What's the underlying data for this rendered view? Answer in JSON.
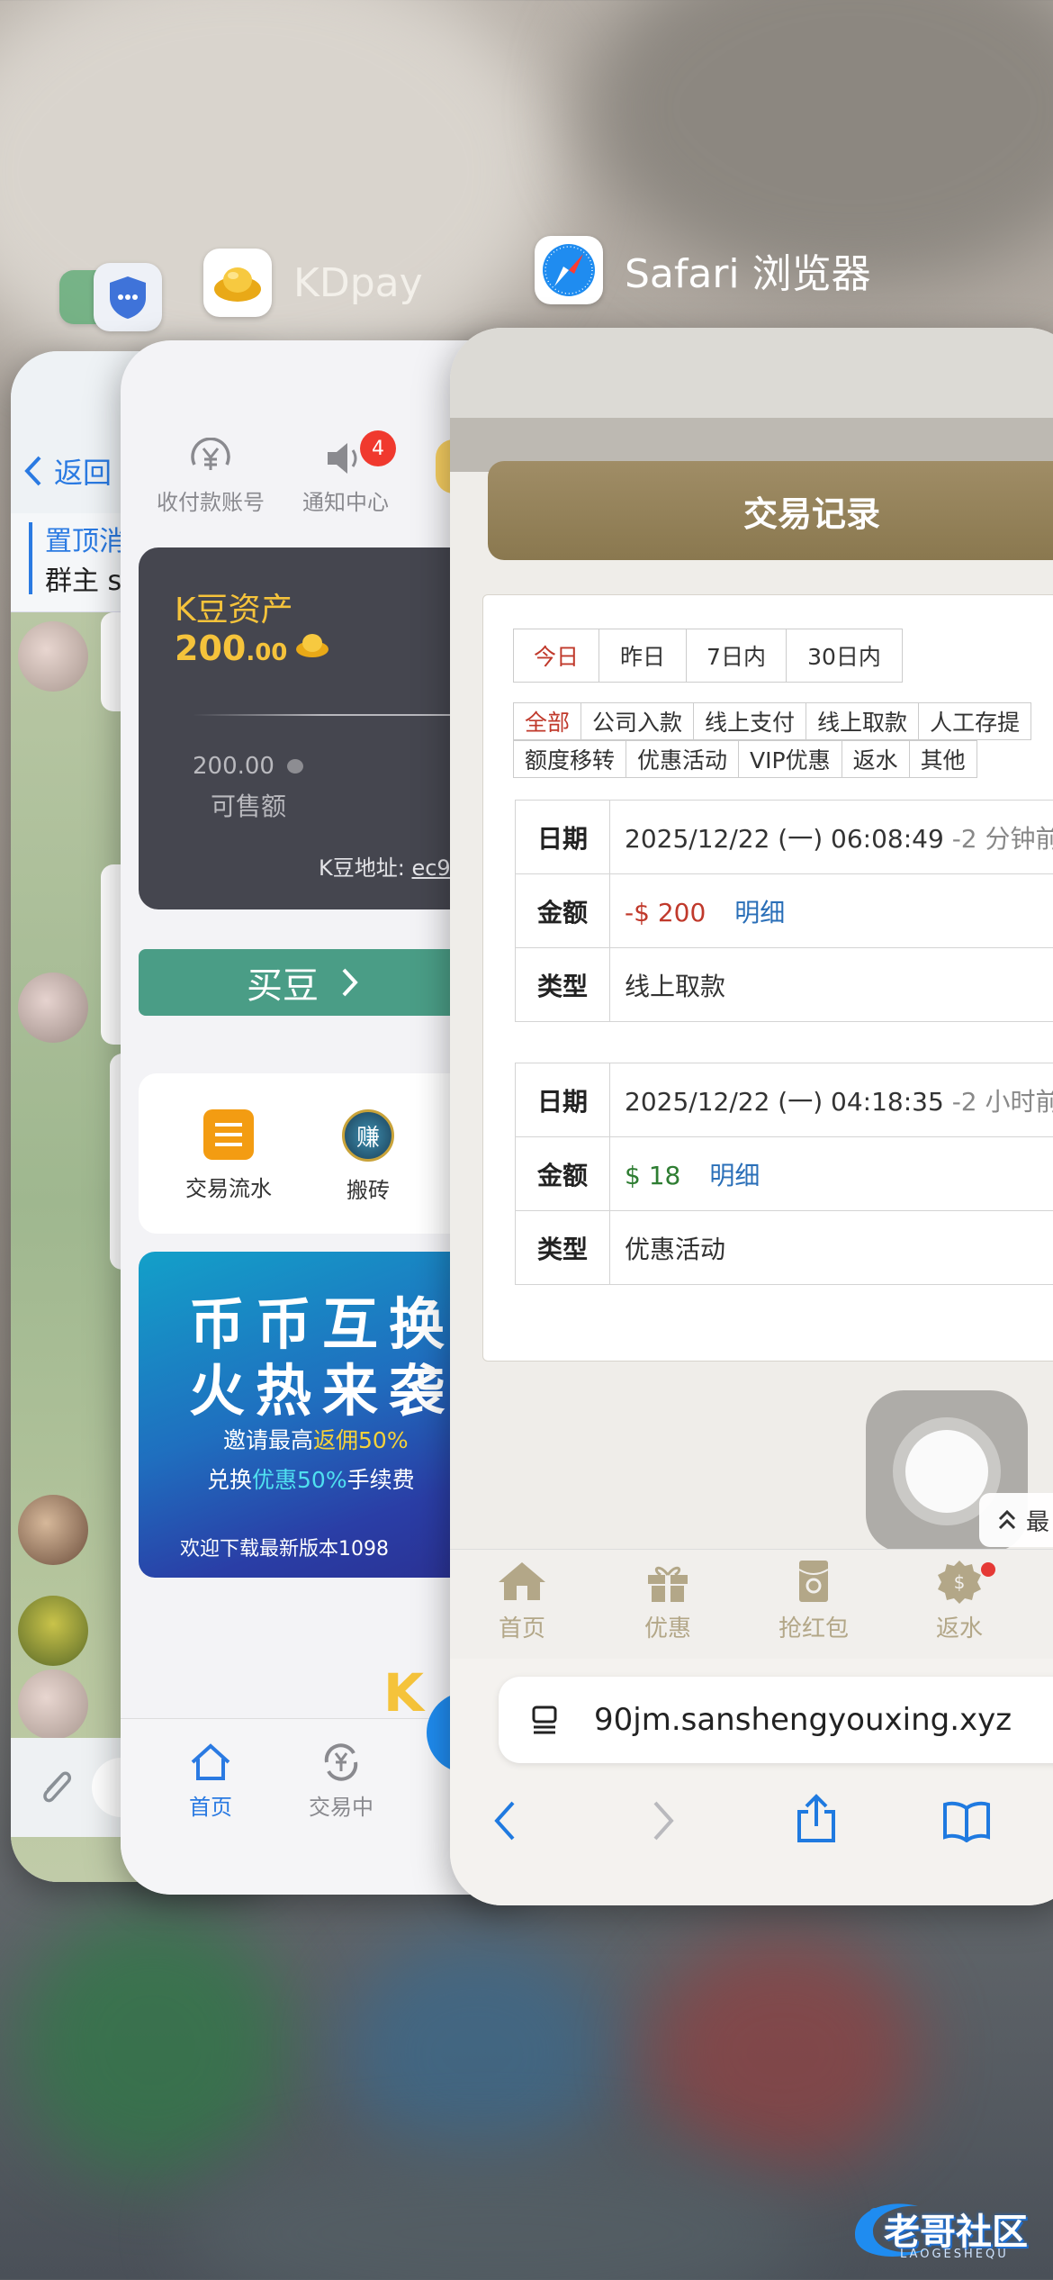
{
  "apps": {
    "kdpay_label": "KDpay",
    "safari_label": "Safari 浏览器"
  },
  "chat": {
    "back": "返回",
    "pinned": "置顶消",
    "group_owner": "群主 s"
  },
  "kdpay": {
    "nav": [
      "收付款账号",
      "通知中心"
    ],
    "notify_badge": "4",
    "asset_title": "K豆资产",
    "asset_int": "200",
    "asset_dec": ".00",
    "sellable_value": "200.00",
    "sellable_label": "可售额",
    "address_label": "K豆地址:",
    "address_value": "ec9",
    "buy_button": "买豆",
    "grid": [
      "交易流水",
      "搬砖"
    ],
    "grid_badge": "赚",
    "banner": {
      "line1": "币币互换",
      "line2": "火热来袭",
      "invite_pre": "邀请最高",
      "invite_hi": "返佣50%",
      "swap_pre": "兑换",
      "swap_hi": "优惠50%",
      "swap_post": "手续费",
      "download": "欢迎下载最新版本1098"
    },
    "tabbar": [
      "首页",
      "交易中"
    ]
  },
  "safari": {
    "page_title": "交易记录",
    "range_filters": [
      "今日",
      "昨日",
      "7日内",
      "30日内"
    ],
    "range_active": 0,
    "type_filters_row1": [
      "全部",
      "公司入款",
      "线上支付",
      "线上取款",
      "人工存提"
    ],
    "type_filters_row2": [
      "额度移转",
      "优惠活动",
      "VIP优惠",
      "返水",
      "其他"
    ],
    "type_active": 0,
    "records": [
      {
        "date_label": "日期",
        "date": "2025/12/22 (一) 06:08:49",
        "ago": "-2 分钟前",
        "amount_label": "金额",
        "amount": "-$ 200",
        "detail": "明细",
        "sign": "neg",
        "type_label": "类型",
        "type": "线上取款"
      },
      {
        "date_label": "日期",
        "date": "2025/12/22 (一) 04:18:35",
        "ago": "-2 小时前",
        "amount_label": "金额",
        "amount": "$ 18",
        "detail": "明细",
        "sign": "pos",
        "type_label": "类型",
        "type": "优惠活动"
      }
    ],
    "top_button": "最",
    "bottom_nav": [
      "首页",
      "优惠",
      "抢红包",
      "返水"
    ],
    "url": "90jm.sanshengyouxing.xyz"
  },
  "watermark": {
    "main": "老哥社区",
    "sub": "LAOGESHEQU"
  },
  "colors": {
    "kd_gold": "#f5c33b",
    "kd_green": "#4a9d86",
    "safari_gold": "#a08d66",
    "filter_active": "#c0392b",
    "link_blue": "#2a6fb8"
  }
}
